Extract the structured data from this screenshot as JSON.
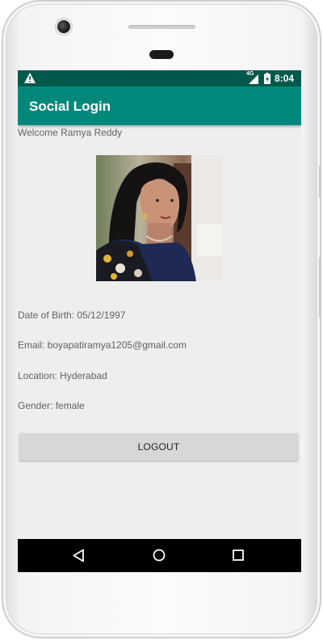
{
  "status_bar": {
    "network_label": "4G",
    "time": "8:04",
    "icons": [
      "warning-icon",
      "signal-icon",
      "battery-icon"
    ]
  },
  "app_bar": {
    "title": "Social Login",
    "color": "#00897b",
    "status_color": "#00594b"
  },
  "profile": {
    "welcome": "Welcome Ramya Reddy",
    "photo_alt": "profile-photo",
    "date_of_birth": "Date of Birth: 05/12/1997",
    "email": "Email: boyapatiramya1205@gmail.com",
    "location": "Location: Hyderabad",
    "gender": "Gender: female"
  },
  "actions": {
    "logout_label": "LOGOUT"
  },
  "nav_bar": {
    "icons": [
      "back-icon",
      "home-icon",
      "recents-icon"
    ]
  }
}
